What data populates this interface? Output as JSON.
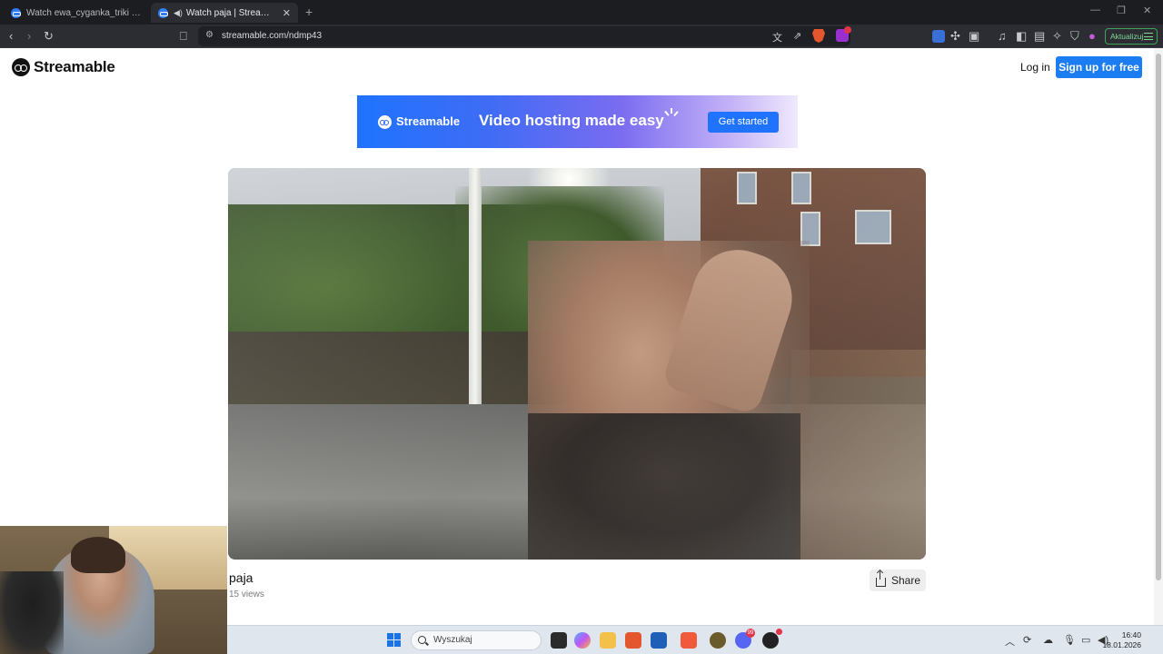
{
  "browser": {
    "tabs": [
      {
        "title": "Watch ewa_cyganka_triki | Streamable",
        "active": false
      },
      {
        "title": "Watch paja | Streamable",
        "active": true
      }
    ],
    "url": "streamable.com/ndmp43",
    "update_label": "Aktualizuj",
    "alert_count": "1"
  },
  "header": {
    "logo_text": "Streamable",
    "login_label": "Log in",
    "signup_label": "Sign up for free"
  },
  "banner": {
    "brand": "Streamable",
    "tagline": "Video hosting made easy",
    "cta_label": "Get started"
  },
  "video": {
    "title": "paja",
    "views": "15 views",
    "share_label": "Share"
  },
  "taskbar": {
    "search_placeholder": "Wyszukaj",
    "time": "16:40",
    "date": "18.01.2026",
    "discord_badge": "99"
  },
  "colors": {
    "accent": "#1c7cf2",
    "browser_bg": "#2c2d33",
    "tabbar_bg": "#1c1d21"
  }
}
